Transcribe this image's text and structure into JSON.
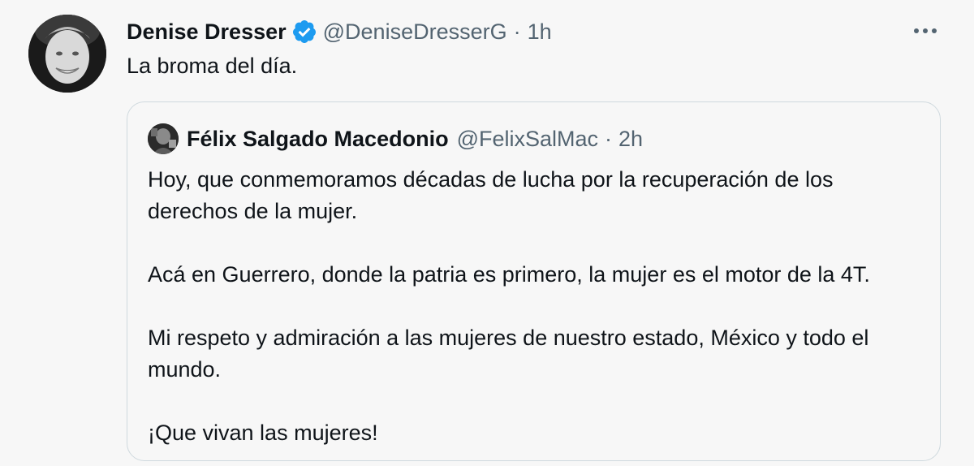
{
  "tweet": {
    "author_name": "Denise Dresser",
    "handle": "@DeniseDresserG",
    "separator": "·",
    "time": "1h",
    "text": "La broma del día."
  },
  "quoted_tweet": {
    "author_name": "Félix Salgado Macedonio",
    "handle": "@FelixSalMac",
    "separator": "·",
    "time": "2h",
    "paragraphs": [
      "Hoy, que conmemoramos décadas de lucha por la recuperación de los derechos de la mujer.",
      "Acá en Guerrero, donde la patria es primero, la mujer es el motor de la 4T.",
      "Mi respeto y admiración a las mujeres de nuestro estado, México y todo el mundo.",
      "¡Que vivan las mujeres!"
    ]
  },
  "icons": {
    "verified": "verified-badge-icon",
    "more": "more-horizontal-icon"
  },
  "colors": {
    "verified_blue": "#1d9bf0",
    "secondary_text": "#536471",
    "border": "#cfd9de",
    "background": "#f7f7f7"
  }
}
